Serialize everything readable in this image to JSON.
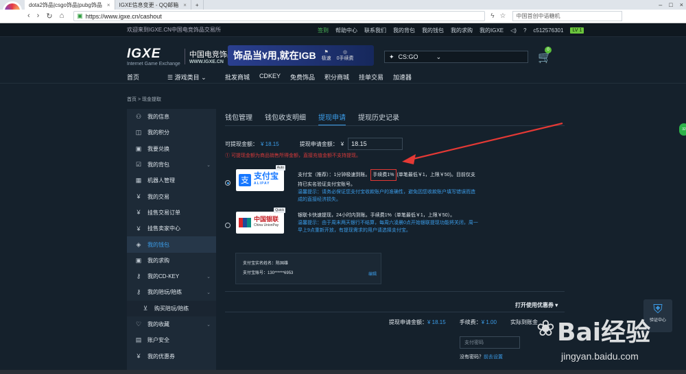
{
  "browser": {
    "tabs": [
      {
        "label": "dota2饰品|csgo饰品|pubg饰品",
        "active": true
      },
      {
        "label": "IGXE信息变更 - QQ邮箱",
        "active": false
      }
    ],
    "new_tab": "+",
    "url_scheme": "https://",
    "url_host": "www.igxe.cn",
    "url_path": "/cashout",
    "search_placeholder": "中国首创中语糖机"
  },
  "top_strip": {
    "welcome": "欢迎来到IGXE.CN中国电竞饰品交易所",
    "sign": "签到",
    "help": "帮助中心",
    "contact": "联系我们",
    "backpack": "我的背包",
    "wallet": "我的钱包",
    "buying": "我的求购",
    "my_igxe": "我的IGXE",
    "user_id": "c512576301",
    "level": "LV 1"
  },
  "header": {
    "logo": "IGXE",
    "logo_sub": "Internet Game Exchange",
    "logo_cn": "中国电竞饰品交易所",
    "logo_www": "WWW.IGXE.CN",
    "banner_text": "饰品当¥用,就在IGB",
    "banner_fast": "极速",
    "banner_fee": "0手续费",
    "game_select": "CS:GO",
    "cart_count": "0"
  },
  "main_nav": {
    "home": "首页",
    "game_category": "游戏类目",
    "wholesale": "批发商城",
    "cdkey": "CDKEY",
    "free": "免费饰品",
    "points": "积分商城",
    "orders": "挂单交易",
    "accelerator": "加速器"
  },
  "breadcrumb": "首页 > 现金提取",
  "sidebar": {
    "items": [
      {
        "label": "我的信息",
        "icon": "user-icon"
      },
      {
        "label": "我的积分",
        "icon": "points-icon"
      },
      {
        "label": "我要兑换",
        "icon": "exchange-icon"
      },
      {
        "label": "我的背包",
        "icon": "bag-icon",
        "chevron": true
      },
      {
        "label": "机器人管理",
        "icon": "robot-icon"
      },
      {
        "label": "我的交易",
        "icon": "yen-icon"
      },
      {
        "label": "挂售交易订单",
        "icon": "yen-icon"
      },
      {
        "label": "挂售卖家中心",
        "icon": "yen-icon"
      },
      {
        "label": "我的钱包",
        "icon": "wallet-icon",
        "active": true
      },
      {
        "label": "我的求购",
        "icon": "buy-icon"
      },
      {
        "label": "我的CD-KEY",
        "icon": "key-icon",
        "chevron": true
      },
      {
        "label": "我的陪玩/陪练",
        "icon": "key-icon",
        "chevron": true
      },
      {
        "label": "购买陪玩/陪练",
        "icon": "cart-icon",
        "sub": true
      },
      {
        "label": "我的收藏",
        "icon": "heart-icon",
        "chevron": true
      },
      {
        "label": "账户安全",
        "icon": "lock-icon"
      },
      {
        "label": "我的优惠券",
        "icon": "coupon-icon"
      }
    ]
  },
  "content": {
    "tabs": [
      "钱包管理",
      "钱包收支明细",
      "提现申请",
      "提现历史记录"
    ],
    "active_tab": 2,
    "withdrawable_label": "可提现金额：",
    "withdrawable_value": "¥ 18.15",
    "apply_label": "提现申请金额：",
    "apply_currency": "¥",
    "apply_value": "18.15",
    "warning": "① 可提现金额为商品销售所得金额，直接充值金额不支持提现。",
    "alipay": {
      "tag": "Auto",
      "name_cn": "支付宝",
      "name_en": "ALIPAY",
      "desc_prefix": "支付宝（推荐）：1分钟极速到账。",
      "desc_fee": "手续费1%",
      "desc_suffix": "(单笔最低￥1，上限￥50)。目前仅支持已实名验证支付宝账号。",
      "tip": "温馨提示：请务必保证您支付宝收款账户的准确性，避免因您收款账户填写错误而造成的直接经济损失。"
    },
    "unionpay": {
      "tag": "Quick",
      "name_cn": "中国银联",
      "name_en": "China UnionPay",
      "desc": "银联卡快速提现，24小时内到账。手续费1%（单笔最低￥1，上限￥50）。",
      "tip": "温馨提示：由于周末两天银行不结算，每周六凌晨0点开始银联提现功能将关闭，周一早上9点重新开放，有提现需求的用户请选择支付宝。"
    },
    "account": {
      "name_label": "支付宝实名姓名：",
      "name_value": "陈国雄",
      "acct_label": "支付宝账号：",
      "acct_value": "130******6953",
      "edit": "编辑"
    },
    "coupon_toggle": "打开使用优惠券 ▾",
    "summary": {
      "apply_label": "提现申请金额：",
      "apply_value": "¥ 18.15",
      "fee_label": "手续费：",
      "fee_value": "¥ 1.00",
      "actual_label": "实际到账金"
    },
    "pay_password_placeholder": "支付密码",
    "forgot_prefix": "没有密码？",
    "forgot_link": "前去设置"
  },
  "float": {
    "verify": "验证中心",
    "bubble": "32"
  },
  "watermark": {
    "main": "Bai经验",
    "sub": "jingyan.baidu.com"
  },
  "colors": {
    "accent": "#3b9ce8",
    "warning": "#d93a3a",
    "background": "#15212c",
    "sidebar": "#1d2a37",
    "arrow": "#e53935"
  }
}
